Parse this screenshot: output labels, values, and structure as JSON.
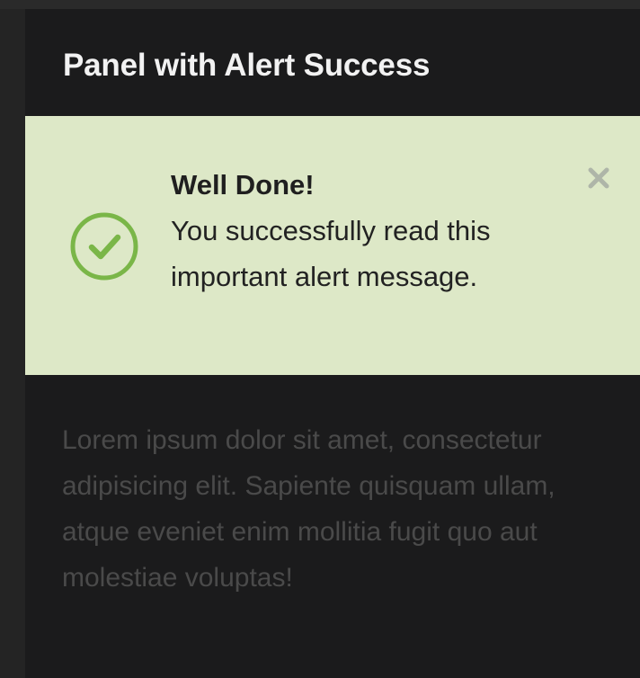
{
  "panel": {
    "heading": "Panel with Alert Success",
    "body": "Lorem ipsum dolor sit amet, consectetur adipisicing elit. Sapiente quisquam ullam, atque eveniet enim mollitia fugit quo aut molestiae voluptas!"
  },
  "alert": {
    "title": "Well Done!",
    "message": "You successfully read this important alert message.",
    "icon": "check-circle-icon",
    "close_icon": "close-icon",
    "colors": {
      "background": "#dde8c7",
      "icon": "#7ab648"
    }
  }
}
